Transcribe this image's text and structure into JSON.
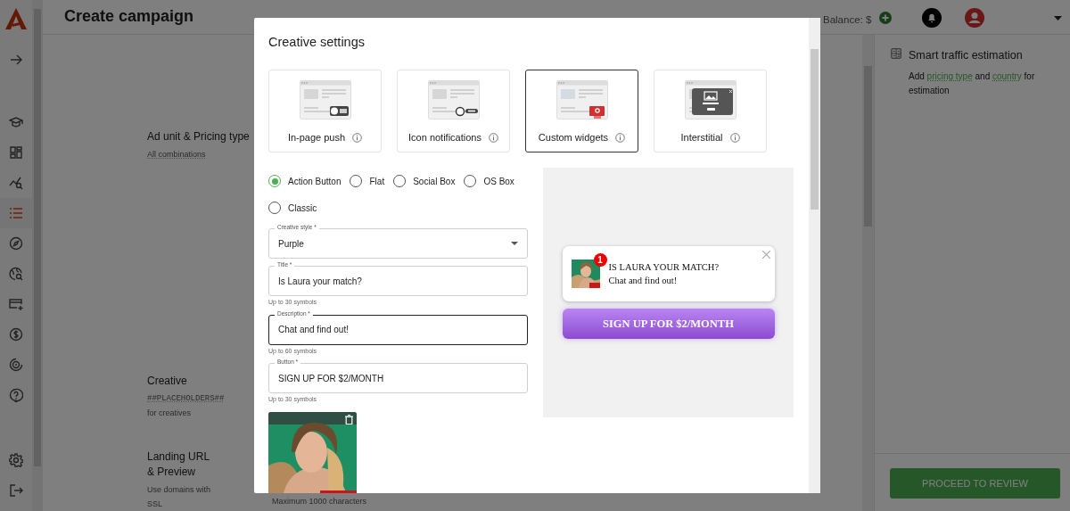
{
  "sidebar": {
    "items": [
      {
        "selected": false
      },
      {
        "selected": false
      },
      {
        "selected": false
      },
      {
        "selected": false
      },
      {
        "selected": true
      },
      {
        "selected": false
      },
      {
        "selected": false
      },
      {
        "selected": false
      },
      {
        "selected": false
      },
      {
        "selected": false
      },
      {
        "selected": false
      },
      {
        "selected": false
      },
      {
        "selected": false
      }
    ]
  },
  "header": {
    "title": "Create campaign",
    "balance": "Balance: $"
  },
  "sections": [
    {
      "title": "Ad unit & Pricing type",
      "lines": [
        {
          "kind": "link",
          "text": "All combinations"
        }
      ]
    },
    {
      "title": "Creative",
      "lines": [
        {
          "kind": "code",
          "text": "##PLACEHOLDERS##"
        },
        {
          "kind": "text",
          "text": "for creatives"
        }
      ]
    },
    {
      "title": "Landing URL & Preview",
      "lines": [
        {
          "kind": "text",
          "text": "Use domains with SSL"
        }
      ]
    }
  ],
  "background_note": "Maximum 1000 characters",
  "estimation": {
    "title": "Smart traffic estimation",
    "parts": [
      {
        "text": "Add "
      },
      {
        "text": "pricing type",
        "link": true
      },
      {
        "text": " and "
      },
      {
        "text": "country",
        "link": true
      },
      {
        "text": " for estimation"
      }
    ]
  },
  "proceed_button": "PROCEED TO REVIEW",
  "dialog": {
    "title": "Creative settings",
    "ad_units": [
      {
        "kind": "inpage",
        "label": "In-page push",
        "selected": false
      },
      {
        "kind": "icon",
        "label": "Icon notifications",
        "selected": false
      },
      {
        "kind": "widget",
        "label": "Custom widgets",
        "selected": true
      },
      {
        "kind": "interstitial",
        "label": "Interstitial",
        "selected": false
      }
    ],
    "formats": [
      {
        "label": "Action Button",
        "selected": true
      },
      {
        "label": "Flat",
        "selected": false
      },
      {
        "label": "Social Box",
        "selected": false
      },
      {
        "label": "OS Box",
        "selected": false
      },
      {
        "label": "Classic",
        "selected": false
      }
    ],
    "fields": [
      {
        "kind": "select",
        "label": "Creative style *",
        "value": "Purple",
        "focused": false
      },
      {
        "kind": "text",
        "label": "Title *",
        "value": "Is Laura your match?",
        "hint": "Up to 30 symbols",
        "focused": false
      },
      {
        "kind": "text",
        "label": "Description *",
        "value": "Chat and find out!",
        "hint": "Up to 60 symbols",
        "focused": true
      },
      {
        "kind": "text",
        "label": "Button *",
        "value": "SIGN UP FOR $2/MONTH",
        "hint": "Up to 30 symbols",
        "focused": false
      }
    ],
    "preview": {
      "badge": "1",
      "title": "IS LAURA YOUR MATCH?",
      "description": "Chat and find out!",
      "button": "SIGN UP FOR $2/MONTH"
    }
  }
}
